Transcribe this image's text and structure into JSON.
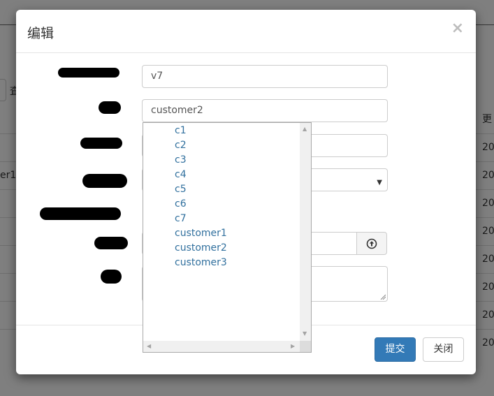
{
  "background": {
    "search_text": "査",
    "column_header": "更",
    "rows": [
      {
        "left": "",
        "right": "20"
      },
      {
        "left": "er1",
        "right": "20"
      },
      {
        "left": "",
        "right": "20"
      },
      {
        "left": "",
        "right": "20"
      },
      {
        "left": "",
        "right": "20"
      },
      {
        "left": "",
        "right": "20"
      },
      {
        "left": "",
        "right": "20"
      },
      {
        "left": "",
        "right": "20"
      }
    ]
  },
  "modal": {
    "title": "编辑",
    "close_symbol": "×",
    "fields": {
      "field1_value": "v7",
      "field2_value": "customer2",
      "field3_value": "",
      "select_value": "",
      "file_value": "",
      "textarea_value": ""
    },
    "icons": {
      "select_arrow": "caret-down-icon",
      "upload": "upload-circle-icon"
    },
    "dropdown_options": [
      "c1",
      "c2",
      "c3",
      "c4",
      "c5",
      "c6",
      "c7",
      "customer1",
      "customer2",
      "customer3"
    ],
    "footer": {
      "submit_label": "提交",
      "close_label": "关闭"
    }
  },
  "colors": {
    "primary": "#337ab7",
    "link": "#31709e",
    "overlay": "rgba(0,0,0,0.5)"
  }
}
